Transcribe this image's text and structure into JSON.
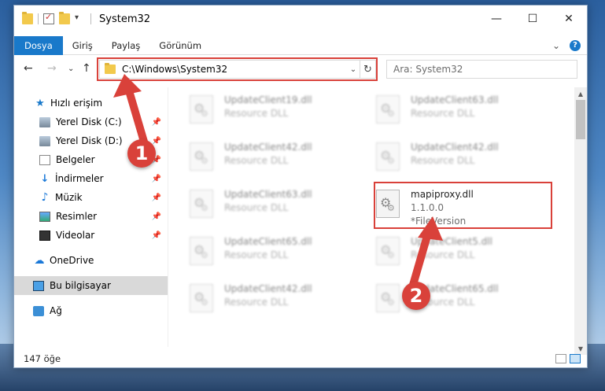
{
  "window": {
    "title": "System32",
    "minimize": "—",
    "maximize": "☐",
    "close": "✕"
  },
  "ribbon": {
    "tabs": [
      "Dosya",
      "Giriş",
      "Paylaş",
      "Görünüm"
    ],
    "expand": "⌄",
    "help": "?"
  },
  "nav": {
    "back": "←",
    "forward": "→",
    "recent": "⌄",
    "up": "↑"
  },
  "address": {
    "path": "C:\\Windows\\System32",
    "chevron": "⌄",
    "refresh": "↻"
  },
  "search": {
    "placeholder": "Ara: System32"
  },
  "sidebar": {
    "quick_access": "Hızlı erişim",
    "items": [
      {
        "label": "Yerel Disk (C:)",
        "icon": "drive-icon"
      },
      {
        "label": "Yerel Disk (D:)",
        "icon": "drive-icon"
      },
      {
        "label": "Belgeler",
        "icon": "documents-icon"
      },
      {
        "label": "İndirmeler",
        "icon": "downloads-icon"
      },
      {
        "label": "Müzik",
        "icon": "music-icon"
      },
      {
        "label": "Resimler",
        "icon": "pictures-icon"
      },
      {
        "label": "Videolar",
        "icon": "videos-icon"
      }
    ],
    "pin": "📌",
    "onedrive": "OneDrive",
    "this_pc": "Bu bilgisayar",
    "network": "Ağ"
  },
  "files": {
    "left_column": [
      {
        "name": "UpdateClient19.dll",
        "sub": "Resource DLL"
      },
      {
        "name": "UpdateClient42.dll",
        "sub": "Resource DLL"
      },
      {
        "name": "UpdateClient63.dll",
        "sub": "Resource DLL"
      },
      {
        "name": "UpdateClient65.dll",
        "sub": "Resource DLL"
      },
      {
        "name": "UpdateClient42.dll",
        "sub": "Resource DLL"
      }
    ],
    "right_column": [
      {
        "name": "UpdateClient63.dll",
        "sub": "Resource DLL"
      },
      {
        "name": "UpdateClient42.dll",
        "sub": "Resource DLL"
      },
      {
        "name": "UpdateClient5.dll",
        "sub": "Resource DLL"
      },
      {
        "name": "UpdateClient65.dll",
        "sub": "Resource DLL"
      }
    ],
    "highlighted": {
      "name": "mapiproxy.dll",
      "version": "1.1.0.0",
      "sub": "*FileVersion"
    }
  },
  "status": {
    "count": "147 öğe"
  },
  "annotations": {
    "step1": "1",
    "step2": "2",
    "color": "#d9413a"
  },
  "scroll": {
    "up": "▲",
    "down": "▼"
  }
}
